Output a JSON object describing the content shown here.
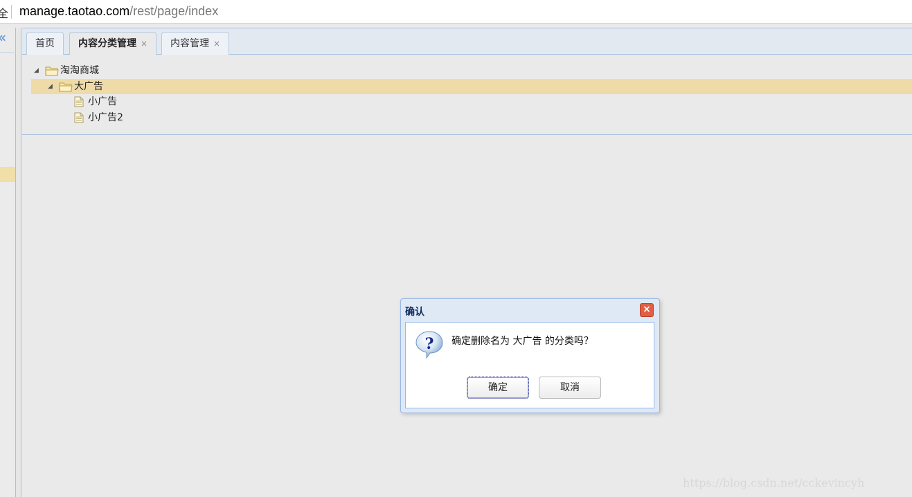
{
  "address_bar": {
    "lead_glyph": "全",
    "url_host": "manage.taotao.com",
    "url_path": "/rest/page/index"
  },
  "left_panel": {
    "collapse_glyph": "«"
  },
  "tabs": [
    {
      "label": "首页",
      "closable": false,
      "active": false
    },
    {
      "label": "内容分类管理",
      "closable": true,
      "active": true
    },
    {
      "label": "内容管理",
      "closable": true,
      "active": false
    }
  ],
  "tab_close_glyph": "×",
  "tree": [
    {
      "label": "淘淘商城",
      "level": 0,
      "type": "folder",
      "expanded": true,
      "selected": false
    },
    {
      "label": "大广告",
      "level": 1,
      "type": "folder",
      "expanded": true,
      "selected": true
    },
    {
      "label": "小广告",
      "level": 2,
      "type": "file",
      "selected": false
    },
    {
      "label": "小广告2",
      "level": 2,
      "type": "file",
      "selected": false
    }
  ],
  "dialog": {
    "title": "确认",
    "close_glyph": "×",
    "message": "确定删除名为 大广告 的分类吗？",
    "icon": "question-icon",
    "ok_label": "确定",
    "cancel_label": "取消"
  },
  "watermark": "https://blog.csdn.net/cckevincyh",
  "colors": {
    "selection": "#efdba8",
    "panel_border": "#a9c1de",
    "dialog_header": "#dfe9f6",
    "close_red": "#e06045"
  }
}
